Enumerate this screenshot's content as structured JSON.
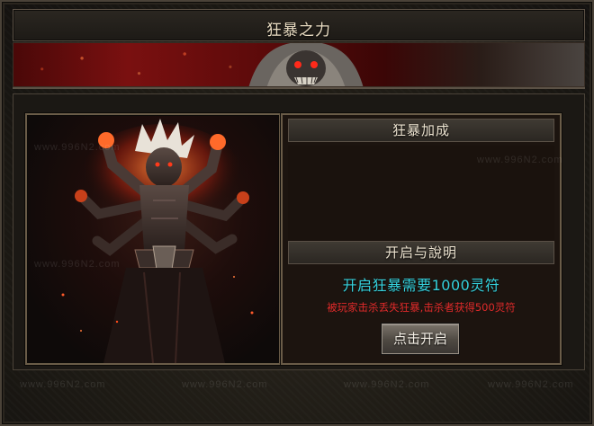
{
  "window": {
    "title": "狂暴之力"
  },
  "watermark": {
    "text": "www.996N2.com"
  },
  "bonus_section": {
    "heading": "狂暴加成"
  },
  "instructions_section": {
    "heading": "开启与說明",
    "cost_text": "开启狂暴需要1000灵符",
    "warning_text": "被玩家击杀丢失狂暴,击杀者获得500灵符"
  },
  "actions": {
    "open_button_label": "点击开启"
  },
  "colors": {
    "cost_text": "#36d2de",
    "warning_text": "#e02a2a",
    "frame_gold": "#6a5c48"
  },
  "icons": {
    "portrait": "rage-demon-portrait",
    "banner": "demon-banner-art"
  }
}
